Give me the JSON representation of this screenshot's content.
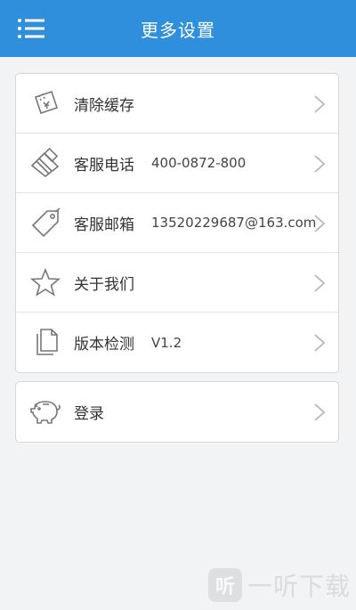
{
  "header": {
    "title": "更多设置",
    "menu_icon": "list-menu-icon"
  },
  "settings": [
    {
      "label": "清除缓存",
      "value": "",
      "icon": "ticket-icon"
    },
    {
      "label": "客服电话",
      "value": "400-0872-800",
      "icon": "card-icon"
    },
    {
      "label": "客服邮箱",
      "value": "13520229687@163.com",
      "icon": "tag-icon"
    },
    {
      "label": "关于我们",
      "value": "",
      "icon": "star-icon"
    },
    {
      "label": "版本检测",
      "value": "V1.2",
      "icon": "document-icon"
    }
  ],
  "account": {
    "label": "登录",
    "icon": "piggy-bank-icon"
  },
  "watermark": {
    "logo_text": "听",
    "text": "一听下载"
  },
  "colors": {
    "header_bg": "#2f8fdc",
    "icon_stroke": "#777777",
    "chevron": "#b8b8b8"
  }
}
